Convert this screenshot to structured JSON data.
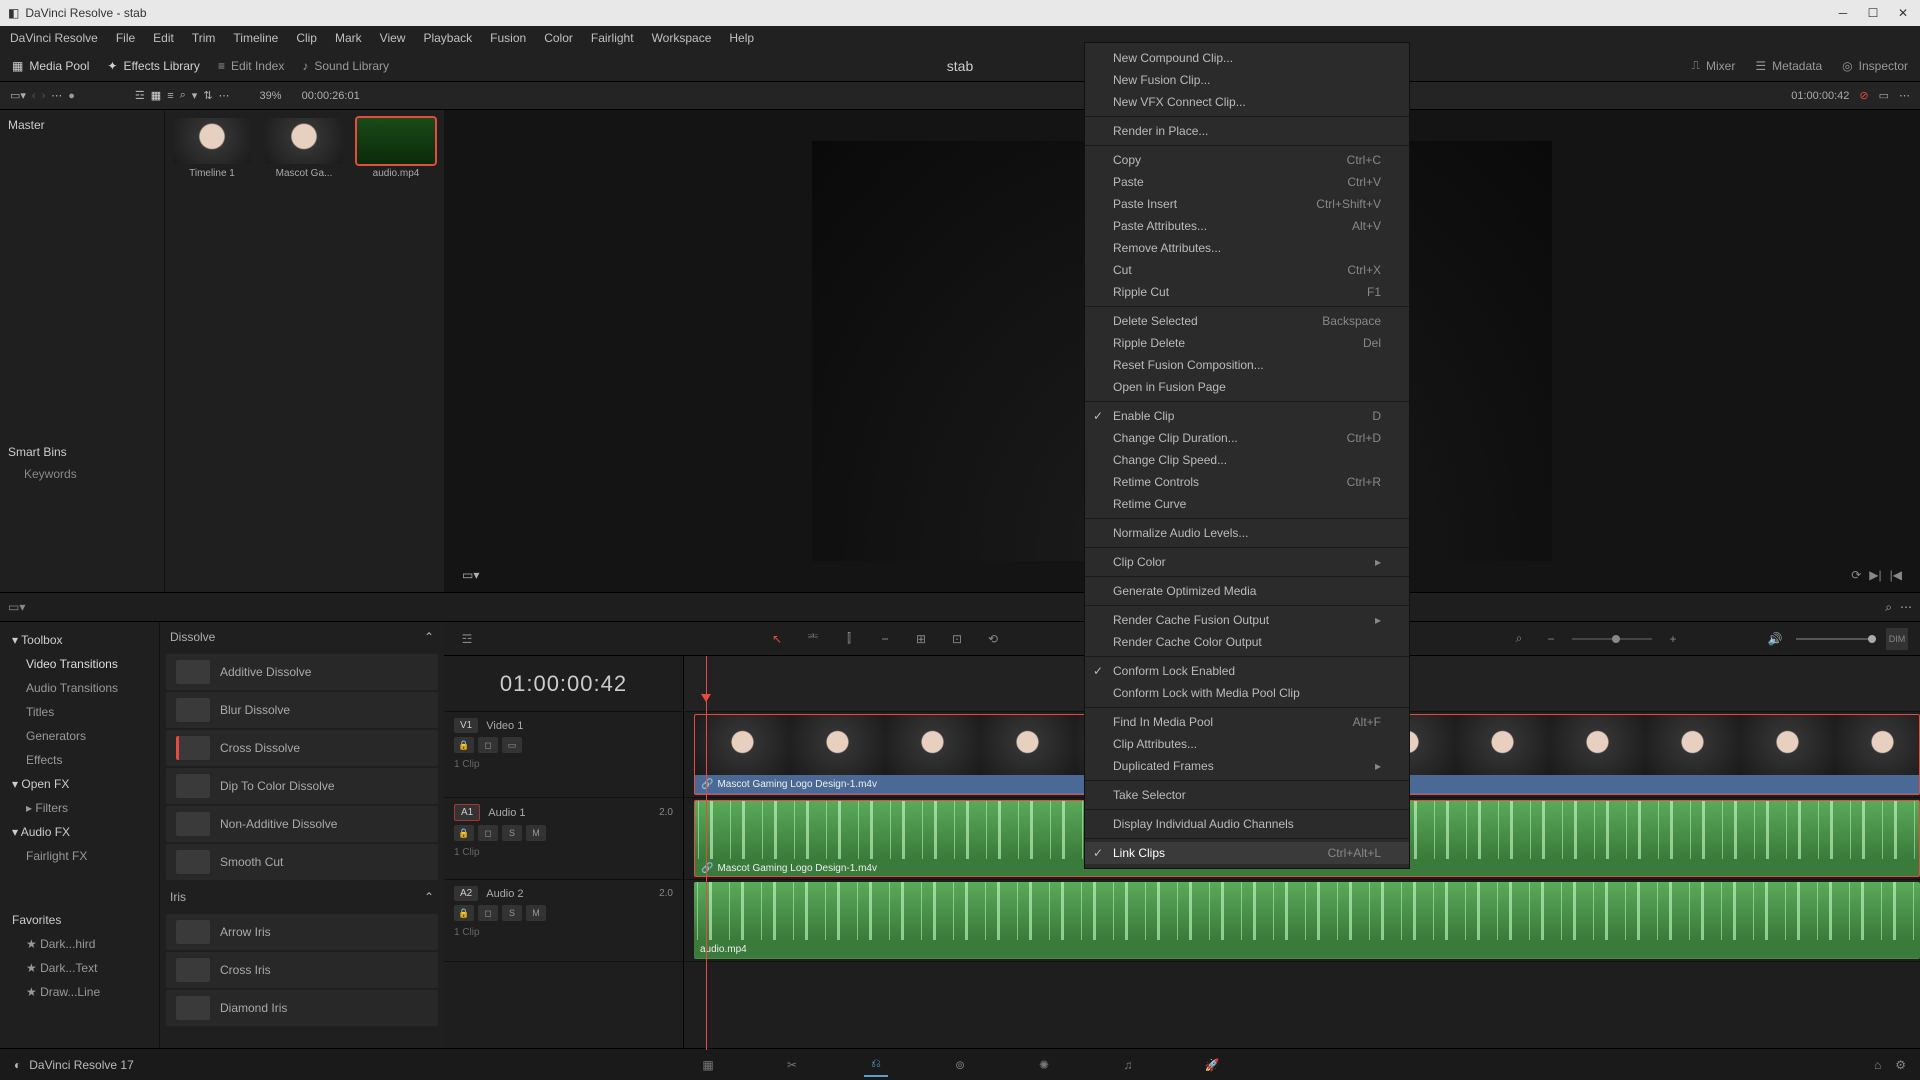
{
  "titlebar": {
    "title": "DaVinci Resolve - stab"
  },
  "menubar": [
    "DaVinci Resolve",
    "File",
    "Edit",
    "Trim",
    "Timeline",
    "Clip",
    "Mark",
    "View",
    "Playback",
    "Fusion",
    "Color",
    "Fairlight",
    "Workspace",
    "Help"
  ],
  "toolbar": {
    "media_pool": "Media Pool",
    "effects_library": "Effects Library",
    "edit_index": "Edit Index",
    "sound_library": "Sound Library",
    "mixer": "Mixer",
    "metadata": "Metadata",
    "inspector": "Inspector",
    "project": "stab"
  },
  "viewopts": {
    "zoom": "39%",
    "src_tc": "00:00:26:01",
    "rec_tc": "01:00:00:42"
  },
  "bins": {
    "master": "Master",
    "smart_bins": "Smart Bins",
    "keywords": "Keywords"
  },
  "clips": [
    {
      "name": "Timeline 1"
    },
    {
      "name": "Mascot Ga..."
    },
    {
      "name": "audio.mp4"
    }
  ],
  "fx_tree": {
    "toolbox": "Toolbox",
    "items": [
      "Video Transitions",
      "Audio Transitions",
      "Titles",
      "Generators",
      "Effects"
    ],
    "openfx": "Open FX",
    "filters": "Filters",
    "audiofx": "Audio FX",
    "fairlight": "Fairlight FX",
    "favorites": "Favorites",
    "fav_items": [
      "Dark...hird",
      "Dark...Text",
      "Draw...Line"
    ]
  },
  "fx_list": {
    "dissolve": "Dissolve",
    "dissolve_items": [
      "Additive Dissolve",
      "Blur Dissolve",
      "Cross Dissolve",
      "Dip To Color Dissolve",
      "Non-Additive Dissolve",
      "Smooth Cut"
    ],
    "iris": "Iris",
    "iris_items": [
      "Arrow Iris",
      "Cross Iris",
      "Diamond Iris"
    ]
  },
  "timeline": {
    "tc": "01:00:00:42",
    "v1": "V1",
    "v1_name": "Video 1",
    "v1_count": "1 Clip",
    "a1": "A1",
    "a1_name": "Audio 1",
    "a1_count": "1 Clip",
    "a1_ch": "2.0",
    "a2": "A2",
    "a2_name": "Audio 2",
    "a2_count": "1 Clip",
    "a2_ch": "2.0",
    "clip_v1": "Mascot Gaming Logo Design-1.m4v",
    "clip_a1": "Mascot Gaming Logo Design-1.m4v",
    "clip_a2": "audio.mp4"
  },
  "context": [
    {
      "label": "New Compound Clip...",
      "type": "item"
    },
    {
      "label": "New Fusion Clip...",
      "type": "item"
    },
    {
      "label": "New VFX Connect Clip...",
      "type": "item"
    },
    {
      "type": "sep"
    },
    {
      "label": "Render in Place...",
      "type": "item"
    },
    {
      "type": "sep"
    },
    {
      "label": "Copy",
      "shortcut": "Ctrl+C",
      "type": "item"
    },
    {
      "label": "Paste",
      "shortcut": "Ctrl+V",
      "type": "item"
    },
    {
      "label": "Paste Insert",
      "shortcut": "Ctrl+Shift+V",
      "type": "item"
    },
    {
      "label": "Paste Attributes...",
      "shortcut": "Alt+V",
      "type": "item"
    },
    {
      "label": "Remove Attributes...",
      "type": "item"
    },
    {
      "label": "Cut",
      "shortcut": "Ctrl+X",
      "type": "item"
    },
    {
      "label": "Ripple Cut",
      "shortcut": "F1",
      "type": "item"
    },
    {
      "type": "sep"
    },
    {
      "label": "Delete Selected",
      "shortcut": "Backspace",
      "type": "item"
    },
    {
      "label": "Ripple Delete",
      "shortcut": "Del",
      "type": "item"
    },
    {
      "label": "Reset Fusion Composition...",
      "type": "item"
    },
    {
      "label": "Open in Fusion Page",
      "type": "item"
    },
    {
      "type": "sep"
    },
    {
      "label": "Enable Clip",
      "shortcut": "D",
      "check": true,
      "type": "item"
    },
    {
      "label": "Change Clip Duration...",
      "shortcut": "Ctrl+D",
      "type": "item"
    },
    {
      "label": "Change Clip Speed...",
      "type": "item"
    },
    {
      "label": "Retime Controls",
      "shortcut": "Ctrl+R",
      "type": "item"
    },
    {
      "label": "Retime Curve",
      "type": "item"
    },
    {
      "type": "sep"
    },
    {
      "label": "Normalize Audio Levels...",
      "type": "item"
    },
    {
      "type": "sep"
    },
    {
      "label": "Clip Color",
      "submenu": true,
      "type": "item"
    },
    {
      "type": "sep"
    },
    {
      "label": "Generate Optimized Media",
      "type": "item"
    },
    {
      "type": "sep"
    },
    {
      "label": "Render Cache Fusion Output",
      "submenu": true,
      "type": "item"
    },
    {
      "label": "Render Cache Color Output",
      "type": "item"
    },
    {
      "type": "sep"
    },
    {
      "label": "Conform Lock Enabled",
      "check": true,
      "type": "item"
    },
    {
      "label": "Conform Lock with Media Pool Clip",
      "type": "item"
    },
    {
      "type": "sep"
    },
    {
      "label": "Find In Media Pool",
      "shortcut": "Alt+F",
      "type": "item"
    },
    {
      "label": "Clip Attributes...",
      "type": "item"
    },
    {
      "label": "Duplicated Frames",
      "submenu": true,
      "type": "item"
    },
    {
      "type": "sep"
    },
    {
      "label": "Take Selector",
      "type": "item"
    },
    {
      "type": "sep"
    },
    {
      "label": "Display Individual Audio Channels",
      "type": "item"
    },
    {
      "type": "sep"
    },
    {
      "label": "Link Clips",
      "shortcut": "Ctrl+Alt+L",
      "check": true,
      "hover": true,
      "type": "item"
    }
  ],
  "bottombar": {
    "app": "DaVinci Resolve 17"
  }
}
